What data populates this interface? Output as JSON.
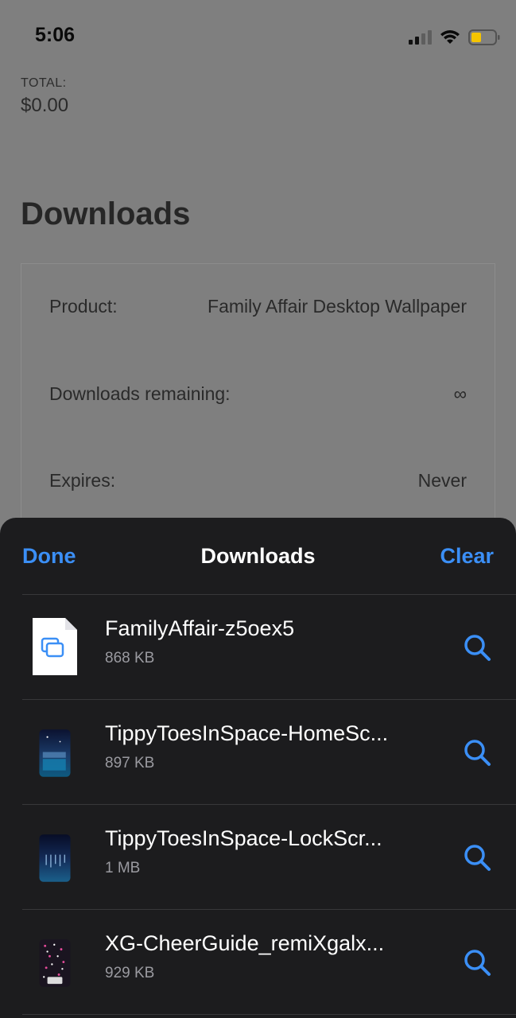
{
  "status_bar": {
    "time": "5:06"
  },
  "background_page": {
    "total_label": "TOTAL:",
    "total_value": "$0.00",
    "section_title": "Downloads",
    "details": [
      {
        "label": "Product:",
        "value": "Family Affair Desktop Wallpaper"
      },
      {
        "label": "Downloads remaining:",
        "value": "∞"
      },
      {
        "label": "Expires:",
        "value": "Never"
      }
    ]
  },
  "downloads_sheet": {
    "done_label": "Done",
    "title": "Downloads",
    "clear_label": "Clear",
    "items": [
      {
        "name": "FamilyAffair-z5oex5",
        "size": "868 KB",
        "thumbnail": "document-icon"
      },
      {
        "name": "TippyToesInSpace-HomeSc...",
        "size": "897 KB",
        "thumbnail": "image-thumbnail"
      },
      {
        "name": "TippyToesInSpace-LockScr...",
        "size": "1 MB",
        "thumbnail": "image-thumbnail"
      },
      {
        "name": "XG-CheerGuide_remiXgalx...",
        "size": "929 KB",
        "thumbnail": "image-thumbnail"
      }
    ]
  },
  "colors": {
    "accent": "#3b8ff6",
    "sheet_bg": "#1c1c1e",
    "battery": "#f5c400"
  }
}
